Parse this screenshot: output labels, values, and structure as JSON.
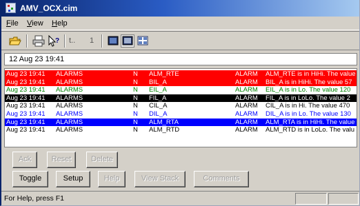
{
  "window": {
    "title": "AMV_OCX.cim"
  },
  "menu": [
    "File",
    "View",
    "Help"
  ],
  "toolbar": {
    "page_label": "t..",
    "page_value": "1"
  },
  "date_field": {
    "value": "12 Aug 23 19:41"
  },
  "alarms": [
    {
      "time": "Aug 23 19:41",
      "category": "ALARMS",
      "flag": "N",
      "tag": "ALM_RTE",
      "type": "ALARM",
      "message": "ALM_RTE is in HiHi. The value",
      "fg": "#ffffff",
      "bg": "#ff0000"
    },
    {
      "time": "Aug 23 19:41",
      "category": "ALARMS",
      "flag": "N",
      "tag": "BIL_A",
      "type": "ALARM",
      "message": "BIL_A is in HiHi. The value 57",
      "fg": "#ffffff",
      "bg": "#ff0000"
    },
    {
      "time": "Aug 23 19:41",
      "category": "ALARMS",
      "flag": "N",
      "tag": "EIL_A",
      "type": "ALARM",
      "message": "EIL_A is in Lo. The value 120",
      "fg": "#008000",
      "bg": "#ffffff"
    },
    {
      "time": "Aug 23 19:41",
      "category": "ALARMS",
      "flag": "N",
      "tag": "FIL_A",
      "type": "ALARM",
      "message": "FIL_A is in LoLo. The value 2",
      "fg": "#ffffff",
      "bg": "#000000"
    },
    {
      "time": "Aug 23 19:41",
      "category": "ALARMS",
      "flag": "N",
      "tag": "CIL_A",
      "type": "ALARM",
      "message": "CIL_A is in Hi. The value 470",
      "fg": "#000000",
      "bg": "#ffffff"
    },
    {
      "time": "Aug 23 19:41",
      "category": "ALARMS",
      "flag": "N",
      "tag": "DIL_A",
      "type": "ALARM",
      "message": "DIL_A is in Lo. The value 130",
      "fg": "#0000ff",
      "bg": "#ffffff"
    },
    {
      "time": "Aug 23 19:41",
      "category": "ALARMS",
      "flag": "N",
      "tag": "ALM_RTA",
      "type": "ALARM",
      "message": "ALM_RTA is in HiHi. The value",
      "fg": "#ffffff",
      "bg": "#0000ff"
    },
    {
      "time": "Aug 23 19:41",
      "category": "ALARMS",
      "flag": "N",
      "tag": "ALM_RTD",
      "type": "ALARM",
      "message": "ALM_RTD is in LoLo. The valu",
      "fg": "#000000",
      "bg": "#ffffff"
    }
  ],
  "buttons_row1": [
    {
      "label": "Ack",
      "enabled": false
    },
    {
      "label": "Reset",
      "enabled": false
    },
    {
      "label": "Delete",
      "enabled": false
    }
  ],
  "buttons_row2": [
    {
      "label": "Toggle",
      "enabled": true
    },
    {
      "label": "Setup",
      "enabled": true
    },
    {
      "label": "Help",
      "enabled": false
    },
    {
      "label": "View Stack",
      "enabled": false
    },
    {
      "label": "Comments",
      "enabled": false
    }
  ],
  "status": {
    "text": "For Help, press F1"
  }
}
